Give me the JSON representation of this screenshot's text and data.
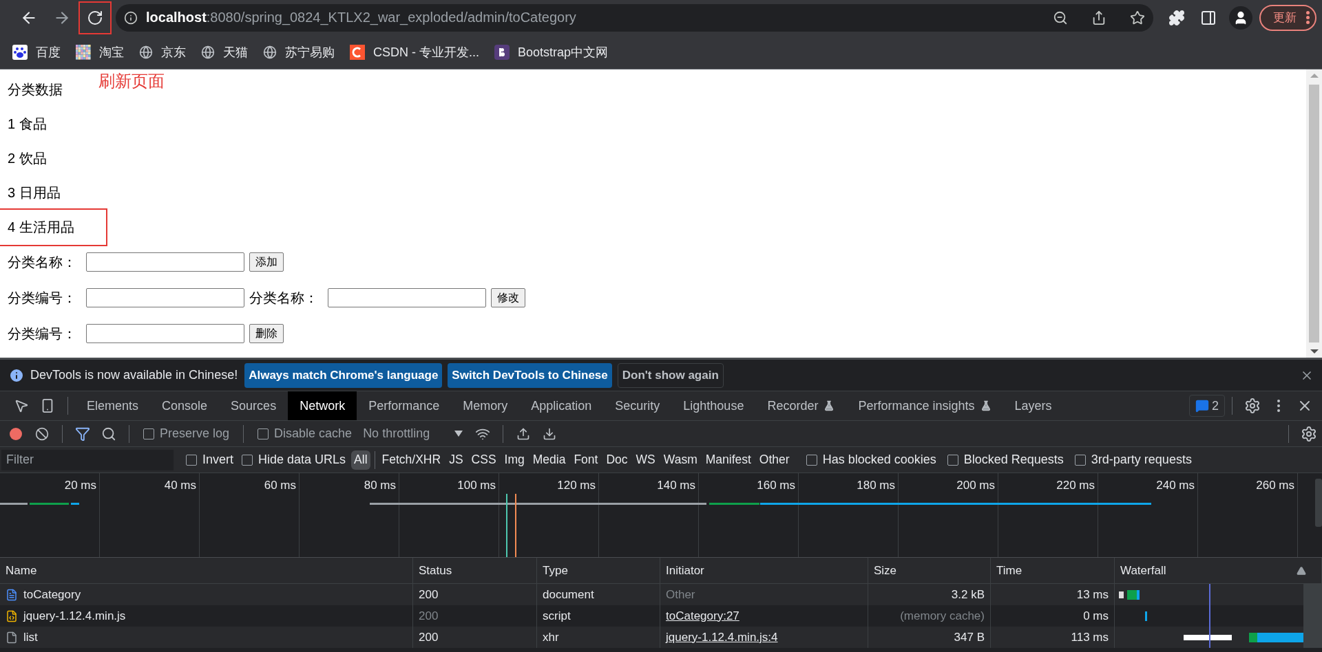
{
  "browser": {
    "url_host": "localhost",
    "url_rest": ":8080/spring_0824_KTLX2_war_exploded/admin/toCategory",
    "update_button": "更新",
    "reload_boxed": true
  },
  "bookmarks": [
    {
      "label": "百度",
      "kind": "baidu"
    },
    {
      "label": "淘宝",
      "kind": "taobao"
    },
    {
      "label": "京东",
      "kind": "globe"
    },
    {
      "label": "天猫",
      "kind": "globe"
    },
    {
      "label": "苏宁易购",
      "kind": "globe"
    },
    {
      "label": "CSDN - 专业开发...",
      "kind": "csdn"
    },
    {
      "label": "Bootstrap中文网",
      "kind": "bootstrap"
    }
  ],
  "annotation": "刷新页面",
  "page": {
    "title": "分类数据",
    "categories": [
      {
        "text": "1 食品",
        "boxed": false
      },
      {
        "text": "2 饮品",
        "boxed": false
      },
      {
        "text": "3 日用品",
        "boxed": false
      },
      {
        "text": "4 生活用品",
        "boxed": true
      }
    ],
    "forms": [
      {
        "fields": [
          "分类名称："
        ],
        "button": "添加"
      },
      {
        "fields": [
          "分类编号：",
          "分类名称："
        ],
        "button": "修改"
      },
      {
        "fields": [
          "分类编号："
        ],
        "button": "删除"
      }
    ]
  },
  "infobar": {
    "message": "DevTools is now available in Chinese!",
    "buttons": [
      "Always match Chrome's language",
      "Switch DevTools to Chinese"
    ],
    "dismiss": "Don't show again"
  },
  "devtools_tabs": [
    {
      "label": "Elements",
      "selected": false,
      "experimental": false
    },
    {
      "label": "Console",
      "selected": false,
      "experimental": false
    },
    {
      "label": "Sources",
      "selected": false,
      "experimental": false
    },
    {
      "label": "Network",
      "selected": true,
      "experimental": false
    },
    {
      "label": "Performance",
      "selected": false,
      "experimental": false
    },
    {
      "label": "Memory",
      "selected": false,
      "experimental": false
    },
    {
      "label": "Application",
      "selected": false,
      "experimental": false
    },
    {
      "label": "Security",
      "selected": false,
      "experimental": false
    },
    {
      "label": "Lighthouse",
      "selected": false,
      "experimental": false
    },
    {
      "label": "Recorder",
      "selected": false,
      "experimental": true
    },
    {
      "label": "Performance insights",
      "selected": false,
      "experimental": true
    },
    {
      "label": "Layers",
      "selected": false,
      "experimental": false
    }
  ],
  "issues_count": "2",
  "toolbar": {
    "checkboxes": [
      {
        "label": "Preserve log",
        "checked": false
      },
      {
        "label": "Disable cache",
        "checked": false
      }
    ],
    "throttling": "No throttling"
  },
  "filter": {
    "placeholder": "Filter",
    "checkboxes": [
      {
        "label": "Invert",
        "checked": false
      },
      {
        "label": "Hide data URLs",
        "checked": false
      }
    ],
    "types": [
      {
        "label": "All",
        "selected": true
      },
      {
        "label": "Fetch/XHR",
        "selected": false
      },
      {
        "label": "JS",
        "selected": false
      },
      {
        "label": "CSS",
        "selected": false
      },
      {
        "label": "Img",
        "selected": false
      },
      {
        "label": "Media",
        "selected": false
      },
      {
        "label": "Font",
        "selected": false
      },
      {
        "label": "Doc",
        "selected": false
      },
      {
        "label": "WS",
        "selected": false
      },
      {
        "label": "Wasm",
        "selected": false
      },
      {
        "label": "Manifest",
        "selected": false
      },
      {
        "label": "Other",
        "selected": false
      }
    ],
    "extra_checkboxes": [
      {
        "label": "Has blocked cookies",
        "checked": false
      },
      {
        "label": "Blocked Requests",
        "checked": false
      },
      {
        "label": "3rd-party requests",
        "checked": false
      }
    ]
  },
  "overview_ticks": [
    "20 ms",
    "40 ms",
    "60 ms",
    "80 ms",
    "100 ms",
    "120 ms",
    "140 ms",
    "160 ms",
    "180 ms",
    "200 ms",
    "220 ms",
    "240 ms",
    "260 ms"
  ],
  "table": {
    "columns": [
      "Name",
      "Status",
      "Type",
      "Initiator",
      "Size",
      "Time",
      "Waterfall"
    ],
    "rows": [
      {
        "kind": "document",
        "name": "toCategory",
        "status": "200",
        "status_dim": false,
        "type": "document",
        "initiator": "Other",
        "initiator_link": false,
        "size": "3.2 kB",
        "size_dim": false,
        "time": "13 ms"
      },
      {
        "kind": "script",
        "name": "jquery-1.12.4.min.js",
        "status": "200",
        "status_dim": true,
        "type": "script",
        "initiator": "toCategory:27",
        "initiator_link": true,
        "size": "(memory cache)",
        "size_dim": true,
        "time": "0 ms"
      },
      {
        "kind": "xhr",
        "name": "list",
        "status": "200",
        "status_dim": false,
        "type": "xhr",
        "initiator": "jquery-1.12.4.min.js:4",
        "initiator_link": true,
        "size": "347 B",
        "size_dim": false,
        "time": "113 ms"
      }
    ]
  }
}
